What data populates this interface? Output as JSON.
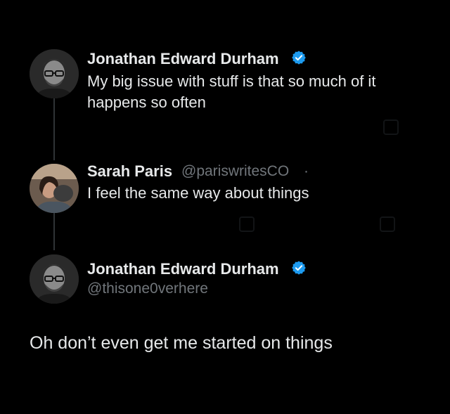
{
  "tweets": [
    {
      "name": "Jonathan Edward Durham",
      "verified": true,
      "text": "My big issue with stuff is that so much of it happens so often"
    },
    {
      "name": "Sarah Paris",
      "handle": "@pariswritesCO",
      "separator": "·",
      "text": "I feel the same way about things"
    },
    {
      "name": "Jonathan Edward Durham",
      "verified": true,
      "handle": "@thisone0verhere",
      "text": "Oh don’t even get me started on things"
    }
  ],
  "colors": {
    "background": "#000000",
    "text": "#e7e9ea",
    "secondary": "#71767b",
    "verified": "#1d9bf0",
    "thread_line": "#2f3336"
  }
}
